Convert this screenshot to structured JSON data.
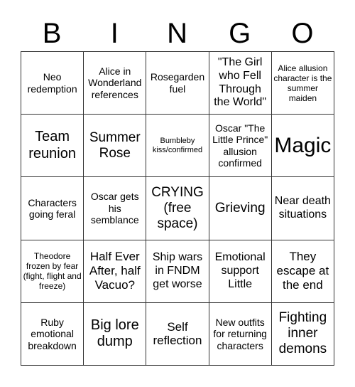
{
  "header": {
    "letters": [
      "B",
      "I",
      "N",
      "G",
      "O"
    ]
  },
  "cells": [
    [
      "Neo redemption",
      "Alice in Wonderland references",
      "Rosegarden fuel",
      "\"The Girl who Fell Through the World\"",
      "Alice allusion character is the summer maiden"
    ],
    [
      "Team reunion",
      "Summer Rose",
      "Bumbleby kiss/confirmed",
      "Oscar \"The Little Prince\" allusion confirmed",
      "Magic"
    ],
    [
      "Characters going feral",
      "Oscar gets his semblance",
      "CRYING (free space)",
      "Grieving",
      "Near death situations"
    ],
    [
      "Theodore frozen by fear (fight, flight and freeze)",
      "Half Ever After, half Vacuo?",
      "Ship wars in FNDM get worse",
      "Emotional support Little",
      "They escape at the end"
    ],
    [
      "Ruby emotional breakdown",
      "Big lore dump",
      "Self reflection",
      "New outfits for returning characters",
      "Fighting inner demons"
    ]
  ]
}
